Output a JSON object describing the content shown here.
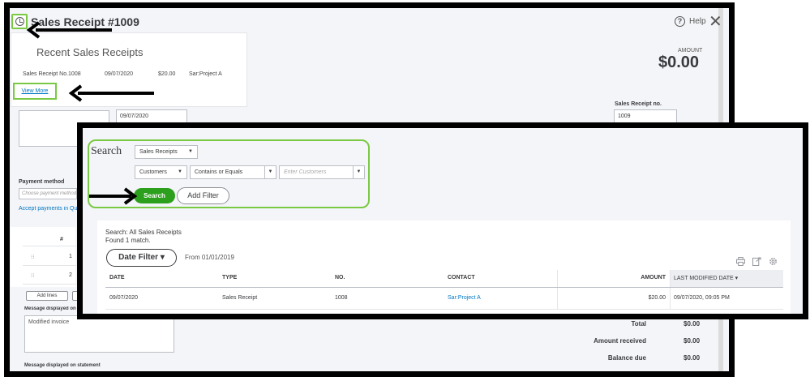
{
  "receipt": {
    "title": "Sales Receipt #1009",
    "help_label": "Help",
    "close_symbol": "✕",
    "amount_label": "AMOUNT",
    "amount_value": "$0.00",
    "receipt_no_label": "Sales Receipt no.",
    "receipt_no_value": "1009",
    "date_value": "09/07/2020",
    "payment_method_label": "Payment method",
    "payment_method_placeholder": "Choose payment method",
    "accept_payments_link": "Accept payments in QuickBooks",
    "line_hash": "#",
    "line_numbers": [
      "1",
      "2"
    ],
    "add_lines_label": "Add lines",
    "message_label": "Message displayed on invoice",
    "message_value": "Modified invoice",
    "statement_label": "Message displayed on statement"
  },
  "recent": {
    "title": "Recent Sales Receipts",
    "row": {
      "name": "Sales Receipt No.1008",
      "date": "09/07/2020",
      "amount": "$20.00",
      "contact": "Sar:Project A"
    },
    "view_more": "View More"
  },
  "totals": [
    {
      "label": "Total",
      "value": "$0.00"
    },
    {
      "label": "Amount received",
      "value": "$0.00"
    },
    {
      "label": "Balance due",
      "value": "$0.00"
    }
  ],
  "search": {
    "heading": "Search",
    "type_select": "Sales Receipts",
    "field_select": "Customers",
    "operator_select": "Contains or Equals",
    "value_placeholder": "Enter Customers",
    "search_button": "Search",
    "add_filter_button": "Add Filter",
    "info_line1": "Search: All Sales Receipts",
    "info_line2": "Found 1 match.",
    "date_filter_label": "Date Filter ▾",
    "from_text": "From 01/01/2019"
  },
  "results": {
    "columns": [
      "DATE",
      "TYPE",
      "NO.",
      "CONTACT",
      "AMOUNT",
      "LAST MODIFIED DATE ▾"
    ],
    "rows": [
      {
        "date": "09/07/2020",
        "type": "Sales Receipt",
        "no": "1008",
        "contact": "Sar:Project A",
        "amount": "$20.00",
        "last_modified": "09/07/2020, 09:05 PM"
      }
    ]
  },
  "icons": {
    "toolbar": [
      "print-icon",
      "export-icon",
      "settings-gear-icon"
    ],
    "history": "clock-history-icon"
  },
  "colors": {
    "accent_green": "#2ca01c",
    "highlight_green": "#7ac943",
    "link_blue": "#0077c5"
  }
}
